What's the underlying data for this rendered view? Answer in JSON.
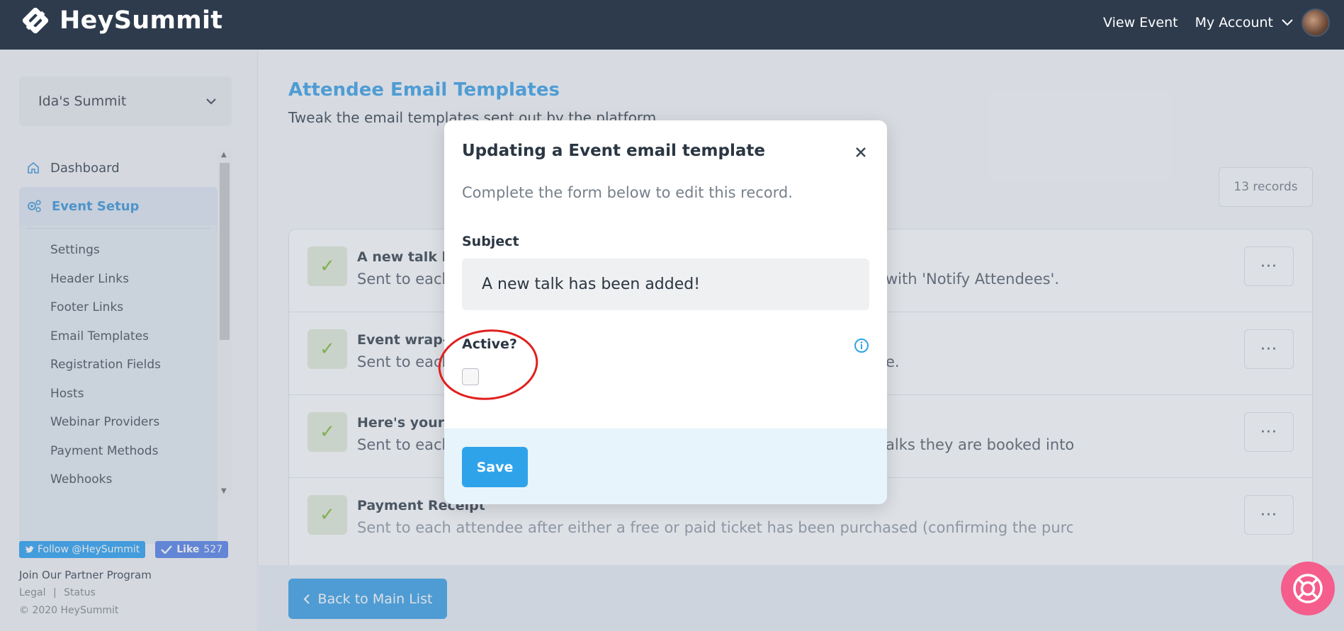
{
  "brand": {
    "name": "HeySummit"
  },
  "topnav": {
    "view_event": "View Event",
    "my_account": "My Account"
  },
  "sidebar": {
    "event_name": "Ida's Summit",
    "nav": [
      {
        "label": "Dashboard",
        "icon": "home-icon"
      },
      {
        "label": "Event Setup",
        "icon": "gears-icon"
      }
    ],
    "sub_items": [
      "Settings",
      "Header Links",
      "Footer Links",
      "Email Templates",
      "Registration Fields",
      "Hosts",
      "Webinar Providers",
      "Payment Methods",
      "Webhooks"
    ],
    "social": {
      "twitter": "Follow @HeySummit",
      "like": "Like",
      "like_count": "527"
    },
    "footer": {
      "partner": "Join Our Partner Program",
      "legal": "Legal",
      "sep": "|",
      "status": "Status",
      "copyright": "© 2020 HeySummit"
    }
  },
  "main": {
    "title": "Attendee Email Templates",
    "subtitle": "Tweak the email templates sent out by the platform",
    "records": "13 records",
    "rows": [
      {
        "title": "A new talk has",
        "desc_left": "Sent to each",
        "desc_right": "with 'Notify Attendees'."
      },
      {
        "title": "Event wrap-up",
        "desc_left": "Sent to each",
        "desc_right": "e."
      },
      {
        "title": "Here's your sc",
        "desc_left": "Sent to each",
        "desc_right": "alks they are booked into"
      },
      {
        "title": "Payment Receipt",
        "desc_left": "Sent to each attendee after either a free or paid ticket has been purchased (confirming the purchas",
        "desc_right": ""
      }
    ],
    "back_button": "Back to Main List"
  },
  "modal": {
    "title": "Updating a Event email template",
    "subtitle": "Complete the form below to edit this record.",
    "subject_label": "Subject",
    "subject_value": "A new talk has been added!",
    "active_label": "Active?",
    "active_checked": false,
    "save": "Save"
  },
  "colors": {
    "topbar": "#2d3b4d",
    "accent": "#2f9be6",
    "annotation": "#e0201e",
    "help": "#f45d8c"
  }
}
